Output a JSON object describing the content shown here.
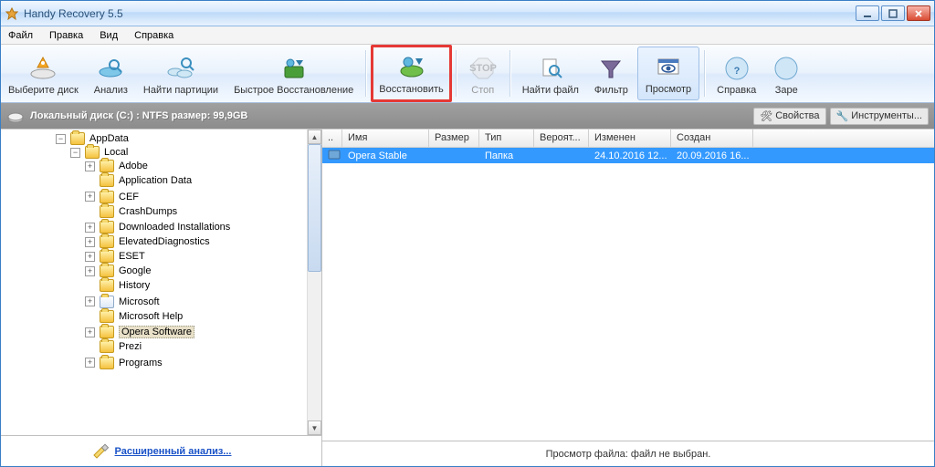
{
  "window": {
    "title": "Handy Recovery 5.5"
  },
  "menu": {
    "file": "Файл",
    "edit": "Правка",
    "view": "Вид",
    "help": "Справка"
  },
  "toolbar": {
    "select_disk": "Выберите диск",
    "analyze": "Анализ",
    "find_partitions": "Найти партиции",
    "quick_restore": "Быстрое Восстановление",
    "restore": "Восстановить",
    "stop": "Стоп",
    "find_file": "Найти файл",
    "filter": "Фильтр",
    "preview": "Просмотр",
    "help": "Справка",
    "reg": "Заре"
  },
  "diskbar": {
    "label": "Локальный диск (C:) : NTFS размер: 99,9GB",
    "properties": "Свойства",
    "tools": "Инструменты..."
  },
  "tree": {
    "root": "AppData",
    "local": "Local",
    "items": [
      "Adobe",
      "Application Data",
      "CEF",
      "CrashDumps",
      "Downloaded Installations",
      "ElevatedDiagnostics",
      "ESET",
      "Google",
      "History",
      "Microsoft",
      "Microsoft Help",
      "Opera Software",
      "Prezi",
      "Programs"
    ],
    "selected_index": 11
  },
  "advanced": {
    "label": "Расширенный анализ..."
  },
  "grid": {
    "columns": {
      "name": "Имя",
      "size": "Размер",
      "type": "Тип",
      "prob": "Вероят...",
      "modified": "Изменен",
      "created": "Создан"
    },
    "row": {
      "name": "Opera Stable",
      "size": "",
      "type": "Папка",
      "prob": "",
      "modified": "24.10.2016 12...",
      "created": "20.09.2016 16..."
    }
  },
  "status": {
    "text": "Просмотр файла: файл не выбран."
  }
}
